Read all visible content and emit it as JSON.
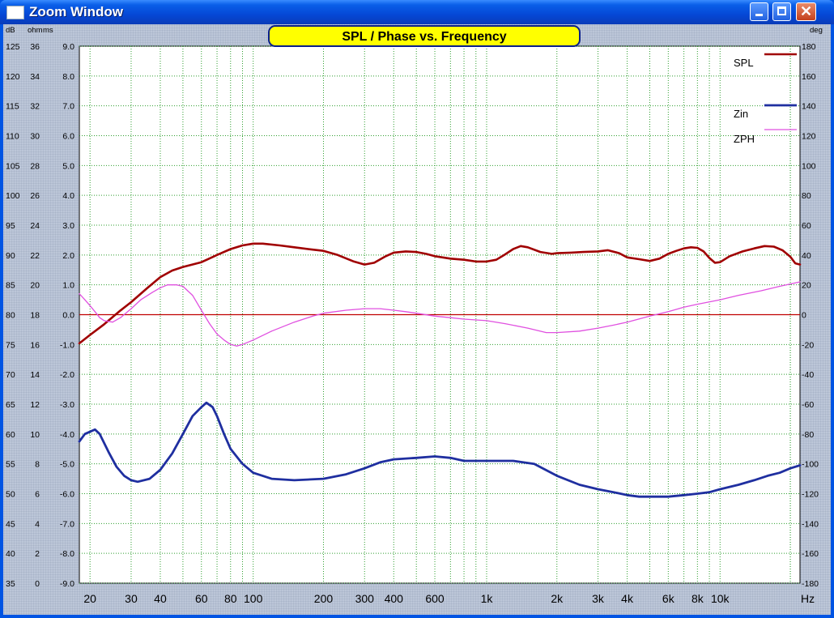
{
  "window": {
    "title": "Zoom Window"
  },
  "chart_data": {
    "type": "line",
    "title": "SPL / Phase vs. Frequency",
    "x_scale": "log",
    "xlim": [
      18,
      22000
    ],
    "x_unit": "Hz",
    "x_ticks": [
      {
        "value": 20,
        "label": "20"
      },
      {
        "value": 30,
        "label": "30"
      },
      {
        "value": 40,
        "label": "40"
      },
      {
        "value": 60,
        "label": "60"
      },
      {
        "value": 80,
        "label": "80"
      },
      {
        "value": 100,
        "label": "100"
      },
      {
        "value": 200,
        "label": "200"
      },
      {
        "value": 300,
        "label": "300"
      },
      {
        "value": 400,
        "label": "400"
      },
      {
        "value": 600,
        "label": "600"
      },
      {
        "value": 1000,
        "label": "1k"
      },
      {
        "value": 2000,
        "label": "2k"
      },
      {
        "value": 3000,
        "label": "3k"
      },
      {
        "value": 4000,
        "label": "4k"
      },
      {
        "value": 6000,
        "label": "6k"
      },
      {
        "value": 8000,
        "label": "8k"
      },
      {
        "value": 10000,
        "label": "10k"
      }
    ],
    "y_axes": {
      "units_left": [
        "dB",
        "ohm",
        "ms"
      ],
      "unit_right": "deg",
      "db": [
        "125",
        "120",
        "115",
        "110",
        "105",
        "100",
        "95",
        "90",
        "85",
        "80",
        "75",
        "70",
        "65",
        "60",
        "55",
        "50",
        "45",
        "40",
        "35"
      ],
      "ohm": [
        "36",
        "34",
        "32",
        "30",
        "28",
        "26",
        "24",
        "22",
        "20",
        "18",
        "16",
        "14",
        "12",
        "10",
        "8",
        "6",
        "4",
        "2",
        "0"
      ],
      "ms": [
        "9.0",
        "8.0",
        "7.0",
        "6.0",
        "5.0",
        "4.0",
        "3.0",
        "2.0",
        "1.0",
        "0.0",
        "-1.0",
        "-2.0",
        "-3.0",
        "-4.0",
        "-5.0",
        "-6.0",
        "-7.0",
        "-8.0",
        "-9.0"
      ],
      "deg": [
        "180",
        "160",
        "140",
        "120",
        "100",
        "80",
        "60",
        "40",
        "20",
        "0",
        "-20",
        "-40",
        "-60",
        "-80",
        "-100",
        "-120",
        "-140",
        "-160",
        "-180"
      ],
      "db_range": [
        35,
        125
      ],
      "ohm_range": [
        0,
        36
      ],
      "deg_range": [
        -180,
        180
      ]
    },
    "grid": true,
    "reference_line_db": 80,
    "colors": {
      "plot_bg": "#ffffff",
      "grid": "#2e9e2e",
      "spl": "#a00000",
      "zin": "#1f2fa0",
      "zph": "#e050e0",
      "zero": "#c00000",
      "title_box": "#ffff00"
    },
    "legend_position": "top-right",
    "series": [
      {
        "name": "SPL",
        "axis": "db",
        "points": [
          [
            18,
            75.2
          ],
          [
            20,
            76.6
          ],
          [
            23,
            78.4
          ],
          [
            27,
            80.7
          ],
          [
            30,
            82.1
          ],
          [
            35,
            84.4
          ],
          [
            40,
            86.3
          ],
          [
            45,
            87.4
          ],
          [
            50,
            88.0
          ],
          [
            60,
            88.8
          ],
          [
            70,
            90.0
          ],
          [
            80,
            91.0
          ],
          [
            90,
            91.6
          ],
          [
            100,
            91.9
          ],
          [
            110,
            91.9
          ],
          [
            130,
            91.6
          ],
          [
            150,
            91.3
          ],
          [
            180,
            90.9
          ],
          [
            200,
            90.7
          ],
          [
            230,
            90.0
          ],
          [
            270,
            88.9
          ],
          [
            300,
            88.4
          ],
          [
            330,
            88.7
          ],
          [
            370,
            89.8
          ],
          [
            400,
            90.4
          ],
          [
            450,
            90.6
          ],
          [
            500,
            90.5
          ],
          [
            550,
            90.2
          ],
          [
            600,
            89.8
          ],
          [
            700,
            89.4
          ],
          [
            800,
            89.2
          ],
          [
            900,
            88.9
          ],
          [
            1000,
            88.9
          ],
          [
            1100,
            89.2
          ],
          [
            1200,
            90.1
          ],
          [
            1300,
            91.0
          ],
          [
            1400,
            91.5
          ],
          [
            1500,
            91.3
          ],
          [
            1700,
            90.5
          ],
          [
            1900,
            90.2
          ],
          [
            2000,
            90.3
          ],
          [
            2300,
            90.4
          ],
          [
            2600,
            90.5
          ],
          [
            3000,
            90.6
          ],
          [
            3300,
            90.8
          ],
          [
            3700,
            90.3
          ],
          [
            4000,
            89.6
          ],
          [
            4500,
            89.3
          ],
          [
            5000,
            89.0
          ],
          [
            5500,
            89.4
          ],
          [
            6000,
            90.2
          ],
          [
            6500,
            90.7
          ],
          [
            7000,
            91.1
          ],
          [
            7500,
            91.3
          ],
          [
            8000,
            91.2
          ],
          [
            8500,
            90.6
          ],
          [
            9000,
            89.5
          ],
          [
            9500,
            88.7
          ],
          [
            10000,
            88.8
          ],
          [
            11000,
            89.8
          ],
          [
            12500,
            90.6
          ],
          [
            14000,
            91.1
          ],
          [
            15500,
            91.5
          ],
          [
            17000,
            91.4
          ],
          [
            18500,
            90.8
          ],
          [
            20000,
            89.7
          ],
          [
            21000,
            88.6
          ],
          [
            22000,
            88.4
          ]
        ]
      },
      {
        "name": "Zin",
        "axis": "ohm",
        "points": [
          [
            18,
            9.5
          ],
          [
            19,
            10.0
          ],
          [
            21,
            10.3
          ],
          [
            22,
            10.0
          ],
          [
            24,
            8.8
          ],
          [
            26,
            7.8
          ],
          [
            28,
            7.2
          ],
          [
            30,
            6.9
          ],
          [
            32,
            6.8
          ],
          [
            36,
            7.0
          ],
          [
            40,
            7.6
          ],
          [
            45,
            8.7
          ],
          [
            50,
            10.0
          ],
          [
            55,
            11.2
          ],
          [
            60,
            11.8
          ],
          [
            63,
            12.1
          ],
          [
            67,
            11.8
          ],
          [
            70,
            11.2
          ],
          [
            75,
            10.0
          ],
          [
            80,
            9.0
          ],
          [
            90,
            8.0
          ],
          [
            100,
            7.4
          ],
          [
            120,
            7.0
          ],
          [
            150,
            6.9
          ],
          [
            200,
            7.0
          ],
          [
            250,
            7.3
          ],
          [
            300,
            7.7
          ],
          [
            350,
            8.1
          ],
          [
            400,
            8.3
          ],
          [
            500,
            8.4
          ],
          [
            600,
            8.5
          ],
          [
            700,
            8.4
          ],
          [
            800,
            8.2
          ],
          [
            1000,
            8.2
          ],
          [
            1300,
            8.2
          ],
          [
            1600,
            8.0
          ],
          [
            2000,
            7.2
          ],
          [
            2500,
            6.6
          ],
          [
            3000,
            6.3
          ],
          [
            3500,
            6.1
          ],
          [
            4000,
            5.9
          ],
          [
            4500,
            5.8
          ],
          [
            5000,
            5.8
          ],
          [
            6000,
            5.8
          ],
          [
            7000,
            5.9
          ],
          [
            8000,
            6.0
          ],
          [
            9000,
            6.1
          ],
          [
            10000,
            6.3
          ],
          [
            12000,
            6.6
          ],
          [
            14000,
            6.9
          ],
          [
            16000,
            7.2
          ],
          [
            18000,
            7.4
          ],
          [
            20000,
            7.7
          ],
          [
            22000,
            7.9
          ]
        ]
      },
      {
        "name": "ZPH",
        "axis": "deg",
        "points": [
          [
            18,
            14
          ],
          [
            19,
            10
          ],
          [
            20,
            6
          ],
          [
            21,
            2
          ],
          [
            22,
            -2
          ],
          [
            23,
            -4
          ],
          [
            25,
            -5
          ],
          [
            27,
            -2
          ],
          [
            30,
            4
          ],
          [
            33,
            10
          ],
          [
            37,
            15
          ],
          [
            40,
            18
          ],
          [
            43,
            20
          ],
          [
            47,
            20
          ],
          [
            50,
            19
          ],
          [
            55,
            13
          ],
          [
            60,
            3
          ],
          [
            65,
            -6
          ],
          [
            70,
            -13
          ],
          [
            75,
            -17
          ],
          [
            80,
            -20
          ],
          [
            85,
            -21
          ],
          [
            90,
            -20
          ],
          [
            100,
            -17
          ],
          [
            120,
            -11
          ],
          [
            150,
            -5
          ],
          [
            180,
            -1
          ],
          [
            200,
            1
          ],
          [
            250,
            3
          ],
          [
            300,
            4
          ],
          [
            350,
            4
          ],
          [
            400,
            3
          ],
          [
            450,
            2
          ],
          [
            500,
            1
          ],
          [
            600,
            -1
          ],
          [
            700,
            -2
          ],
          [
            800,
            -3
          ],
          [
            1000,
            -4
          ],
          [
            1200,
            -6
          ],
          [
            1500,
            -9
          ],
          [
            1800,
            -12
          ],
          [
            2000,
            -12
          ],
          [
            2500,
            -11
          ],
          [
            3000,
            -9
          ],
          [
            3500,
            -7
          ],
          [
            4000,
            -5
          ],
          [
            5000,
            -1
          ],
          [
            6000,
            2
          ],
          [
            7000,
            5
          ],
          [
            8000,
            7
          ],
          [
            10000,
            10
          ],
          [
            12000,
            13
          ],
          [
            15000,
            16
          ],
          [
            18000,
            19
          ],
          [
            22000,
            22
          ]
        ]
      },
      {
        "name": "",
        "axis": "db",
        "type": "reference",
        "points": [
          [
            18,
            80
          ],
          [
            22000,
            80
          ]
        ]
      }
    ]
  }
}
